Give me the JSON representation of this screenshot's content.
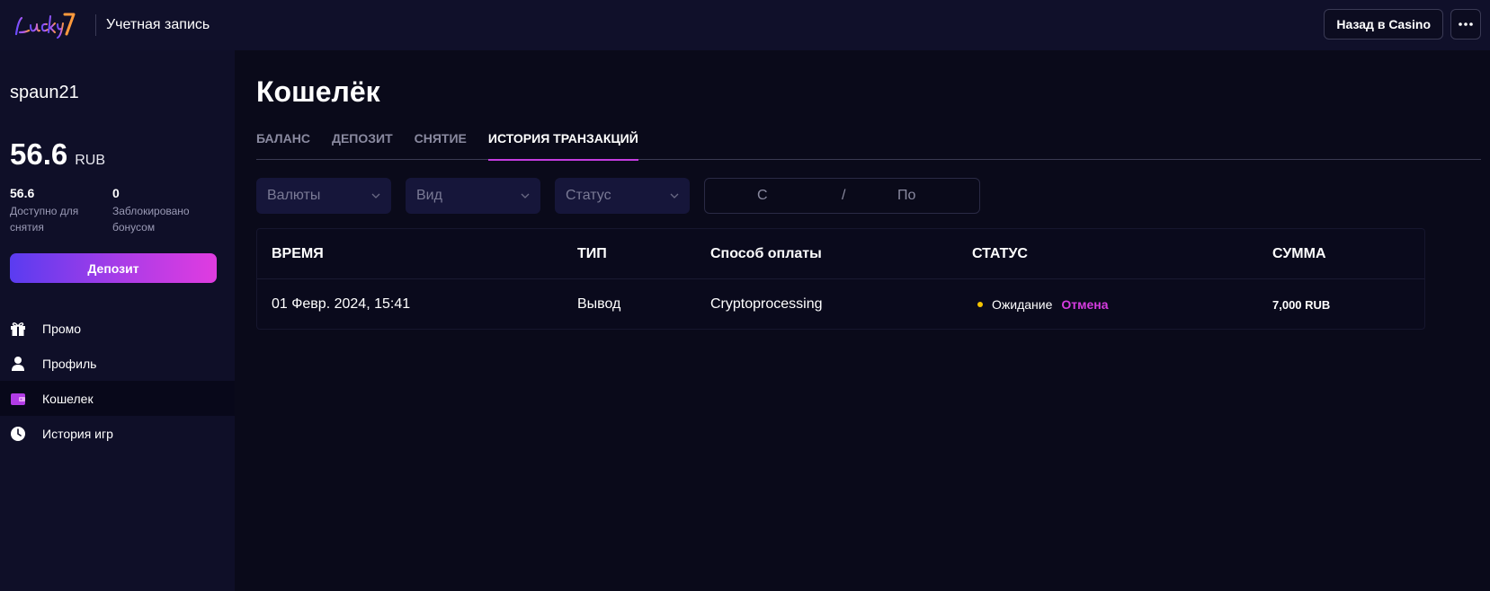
{
  "header": {
    "logo_alt": "Lucky7",
    "title": "Учетная запись",
    "back_label": "Назад в Casino"
  },
  "sidebar": {
    "username": "spaun21",
    "balance": "56.6",
    "currency": "RUB",
    "available_value": "56.6",
    "available_label": "Доступно для снятия",
    "locked_value": "0",
    "locked_label": "Заблокировано бонусом",
    "deposit_label": "Депозит",
    "nav": [
      {
        "label": "Промо",
        "icon": "gift-icon",
        "active": false
      },
      {
        "label": "Профиль",
        "icon": "user-icon",
        "active": false
      },
      {
        "label": "Кошелек",
        "icon": "wallet-icon",
        "active": true
      },
      {
        "label": "История игр",
        "icon": "clock-icon",
        "active": false
      }
    ]
  },
  "main": {
    "title": "Кошелёк",
    "tabs": [
      "БАЛАНС",
      "ДЕПОЗИТ",
      "СНЯТИЕ",
      "ИСТОРИЯ ТРАНЗАКЦИЙ"
    ],
    "active_tab": 3,
    "filters": {
      "currency_placeholder": "Валюты",
      "type_placeholder": "Вид",
      "status_placeholder": "Статус",
      "date_from": "С",
      "date_sep": "/",
      "date_to": "По"
    },
    "table": {
      "headers": {
        "time": "ВРЕМЯ",
        "type": "ТИП",
        "method": "Способ оплаты",
        "status": "СТАТУС",
        "amount": "СУММА"
      },
      "rows": [
        {
          "time": "01 Февр. 2024, 15:41",
          "type": "Вывод",
          "method": "Cryptoprocessing",
          "status": "Ожидание",
          "action": "Отмена",
          "amount": "7,000 RUB"
        }
      ]
    }
  },
  "colors": {
    "accent": "#c43ce0",
    "pending": "#f5c400",
    "background": "#0a0a1a"
  }
}
